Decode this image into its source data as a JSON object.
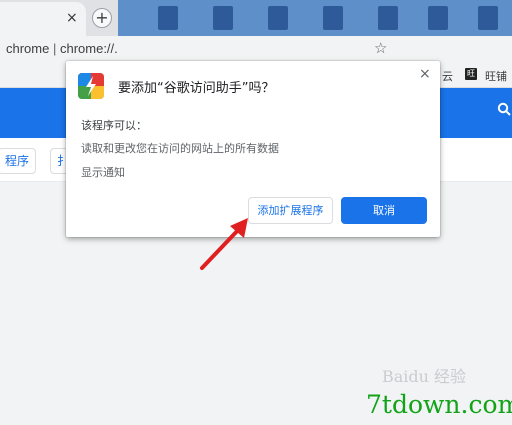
{
  "browser": {
    "tab_close_glyph": "×",
    "new_tab_glyph": "+",
    "url_prefix": "chrome",
    "url_separator": " | ",
    "url_value": "chrome://.",
    "bookmark_partial": "云",
    "bookmark_icon_glyph": "旺",
    "bookmark_label": "旺铺"
  },
  "page": {
    "chip_1": "程序",
    "chip_2": "扌"
  },
  "dialog": {
    "title": "要添加“谷歌访问助手”吗？",
    "close_glyph": "×",
    "permissions_heading": "该程序可以：",
    "permissions": [
      "读取和更改您在访问的网站上的所有数据",
      "显示通知"
    ],
    "add_button_label": "添加扩展程序",
    "cancel_button_label": "取消"
  },
  "colors": {
    "accent": "#1a73e8",
    "annotation_arrow": "#e02020",
    "watermark": "#12a318"
  },
  "watermark": {
    "faint_text": "Baidu 经验",
    "site_text": "7tdown.com"
  }
}
